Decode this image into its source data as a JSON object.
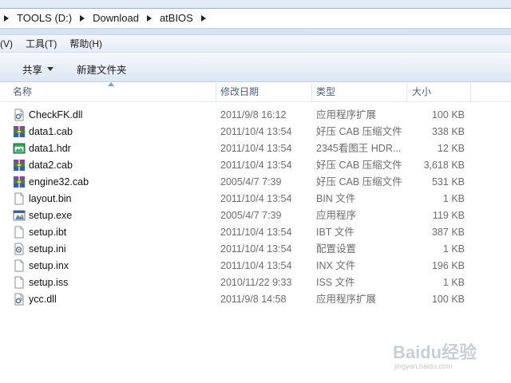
{
  "address_bar": {
    "breadcrumbs": [
      "TOOLS (D:)",
      "Download",
      "atBIOS"
    ]
  },
  "menu": {
    "items": [
      "(V)",
      "工具(T)",
      "帮助(H)"
    ]
  },
  "toolbar": {
    "share_label": "共享",
    "new_folder_label": "新建文件夹"
  },
  "columns": {
    "name": "名称",
    "date": "修改日期",
    "type": "类型",
    "size": "大小"
  },
  "files": [
    {
      "name": "CheckFK.dll",
      "date": "2011/9/8 16:12",
      "type": "应用程序扩展",
      "size": "100 KB",
      "icon": "dll-icon"
    },
    {
      "name": "data1.cab",
      "date": "2011/10/4 13:54",
      "type": "好压 CAB 压缩文件",
      "size": "338 KB",
      "icon": "archive-icon"
    },
    {
      "name": "data1.hdr",
      "date": "2011/10/4 13:54",
      "type": "2345看图王 HDR...",
      "size": "12 KB",
      "icon": "image-viewer-icon"
    },
    {
      "name": "data2.cab",
      "date": "2011/10/4 13:54",
      "type": "好压 CAB 压缩文件",
      "size": "3,618 KB",
      "icon": "archive-icon"
    },
    {
      "name": "engine32.cab",
      "date": "2005/4/7 7:39",
      "type": "好压 CAB 压缩文件",
      "size": "531 KB",
      "icon": "archive-icon"
    },
    {
      "name": "layout.bin",
      "date": "2011/10/4 13:54",
      "type": "BIN 文件",
      "size": "1 KB",
      "icon": "blank-file-icon"
    },
    {
      "name": "setup.exe",
      "date": "2005/4/7 7:39",
      "type": "应用程序",
      "size": "119 KB",
      "icon": "setup-exe-icon"
    },
    {
      "name": "setup.ibt",
      "date": "2011/10/4 13:54",
      "type": "IBT 文件",
      "size": "387 KB",
      "icon": "blank-file-icon"
    },
    {
      "name": "setup.ini",
      "date": "2011/10/4 13:54",
      "type": "配置设置",
      "size": "1 KB",
      "icon": "config-file-icon"
    },
    {
      "name": "setup.inx",
      "date": "2011/10/4 13:54",
      "type": "INX 文件",
      "size": "196 KB",
      "icon": "blank-file-icon"
    },
    {
      "name": "setup.iss",
      "date": "2010/11/22 9:33",
      "type": "ISS 文件",
      "size": "1 KB",
      "icon": "blank-file-icon"
    },
    {
      "name": "ycc.dll",
      "date": "2011/9/8 14:58",
      "type": "应用程序扩展",
      "size": "100 KB",
      "icon": "dll-icon"
    }
  ],
  "watermark": {
    "text": "Baidu经验",
    "sub": "jingyan.baidu.com"
  }
}
